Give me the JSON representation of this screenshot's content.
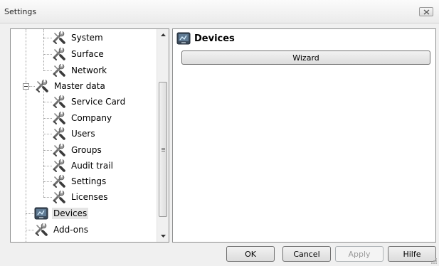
{
  "window": {
    "title": "Settings"
  },
  "tree": {
    "items": [
      {
        "label": "System",
        "icon": "tools-icon"
      },
      {
        "label": "Surface",
        "icon": "tools-icon"
      },
      {
        "label": "Network",
        "icon": "tools-icon"
      },
      {
        "label": "Master data",
        "icon": "tools-icon",
        "expanded": true
      },
      {
        "label": "Service Card",
        "icon": "tools-icon"
      },
      {
        "label": "Company",
        "icon": "tools-icon"
      },
      {
        "label": "Users",
        "icon": "tools-icon"
      },
      {
        "label": "Groups",
        "icon": "tools-icon"
      },
      {
        "label": "Audit trail",
        "icon": "tools-icon"
      },
      {
        "label": "Settings",
        "icon": "tools-icon"
      },
      {
        "label": "Licenses",
        "icon": "tools-icon"
      },
      {
        "label": "Devices",
        "icon": "devices-icon",
        "selected": true
      },
      {
        "label": "Add-ons",
        "icon": "tools-icon"
      }
    ]
  },
  "content": {
    "title": "Devices",
    "icon": "devices-icon",
    "wizard_label": "Wizard"
  },
  "buttons": {
    "ok": "OK",
    "cancel": "Cancel",
    "apply": "Apply",
    "help": "Hilfe"
  },
  "colors": {
    "selection": "#e5e5e5",
    "border": "#8e8f8f"
  }
}
